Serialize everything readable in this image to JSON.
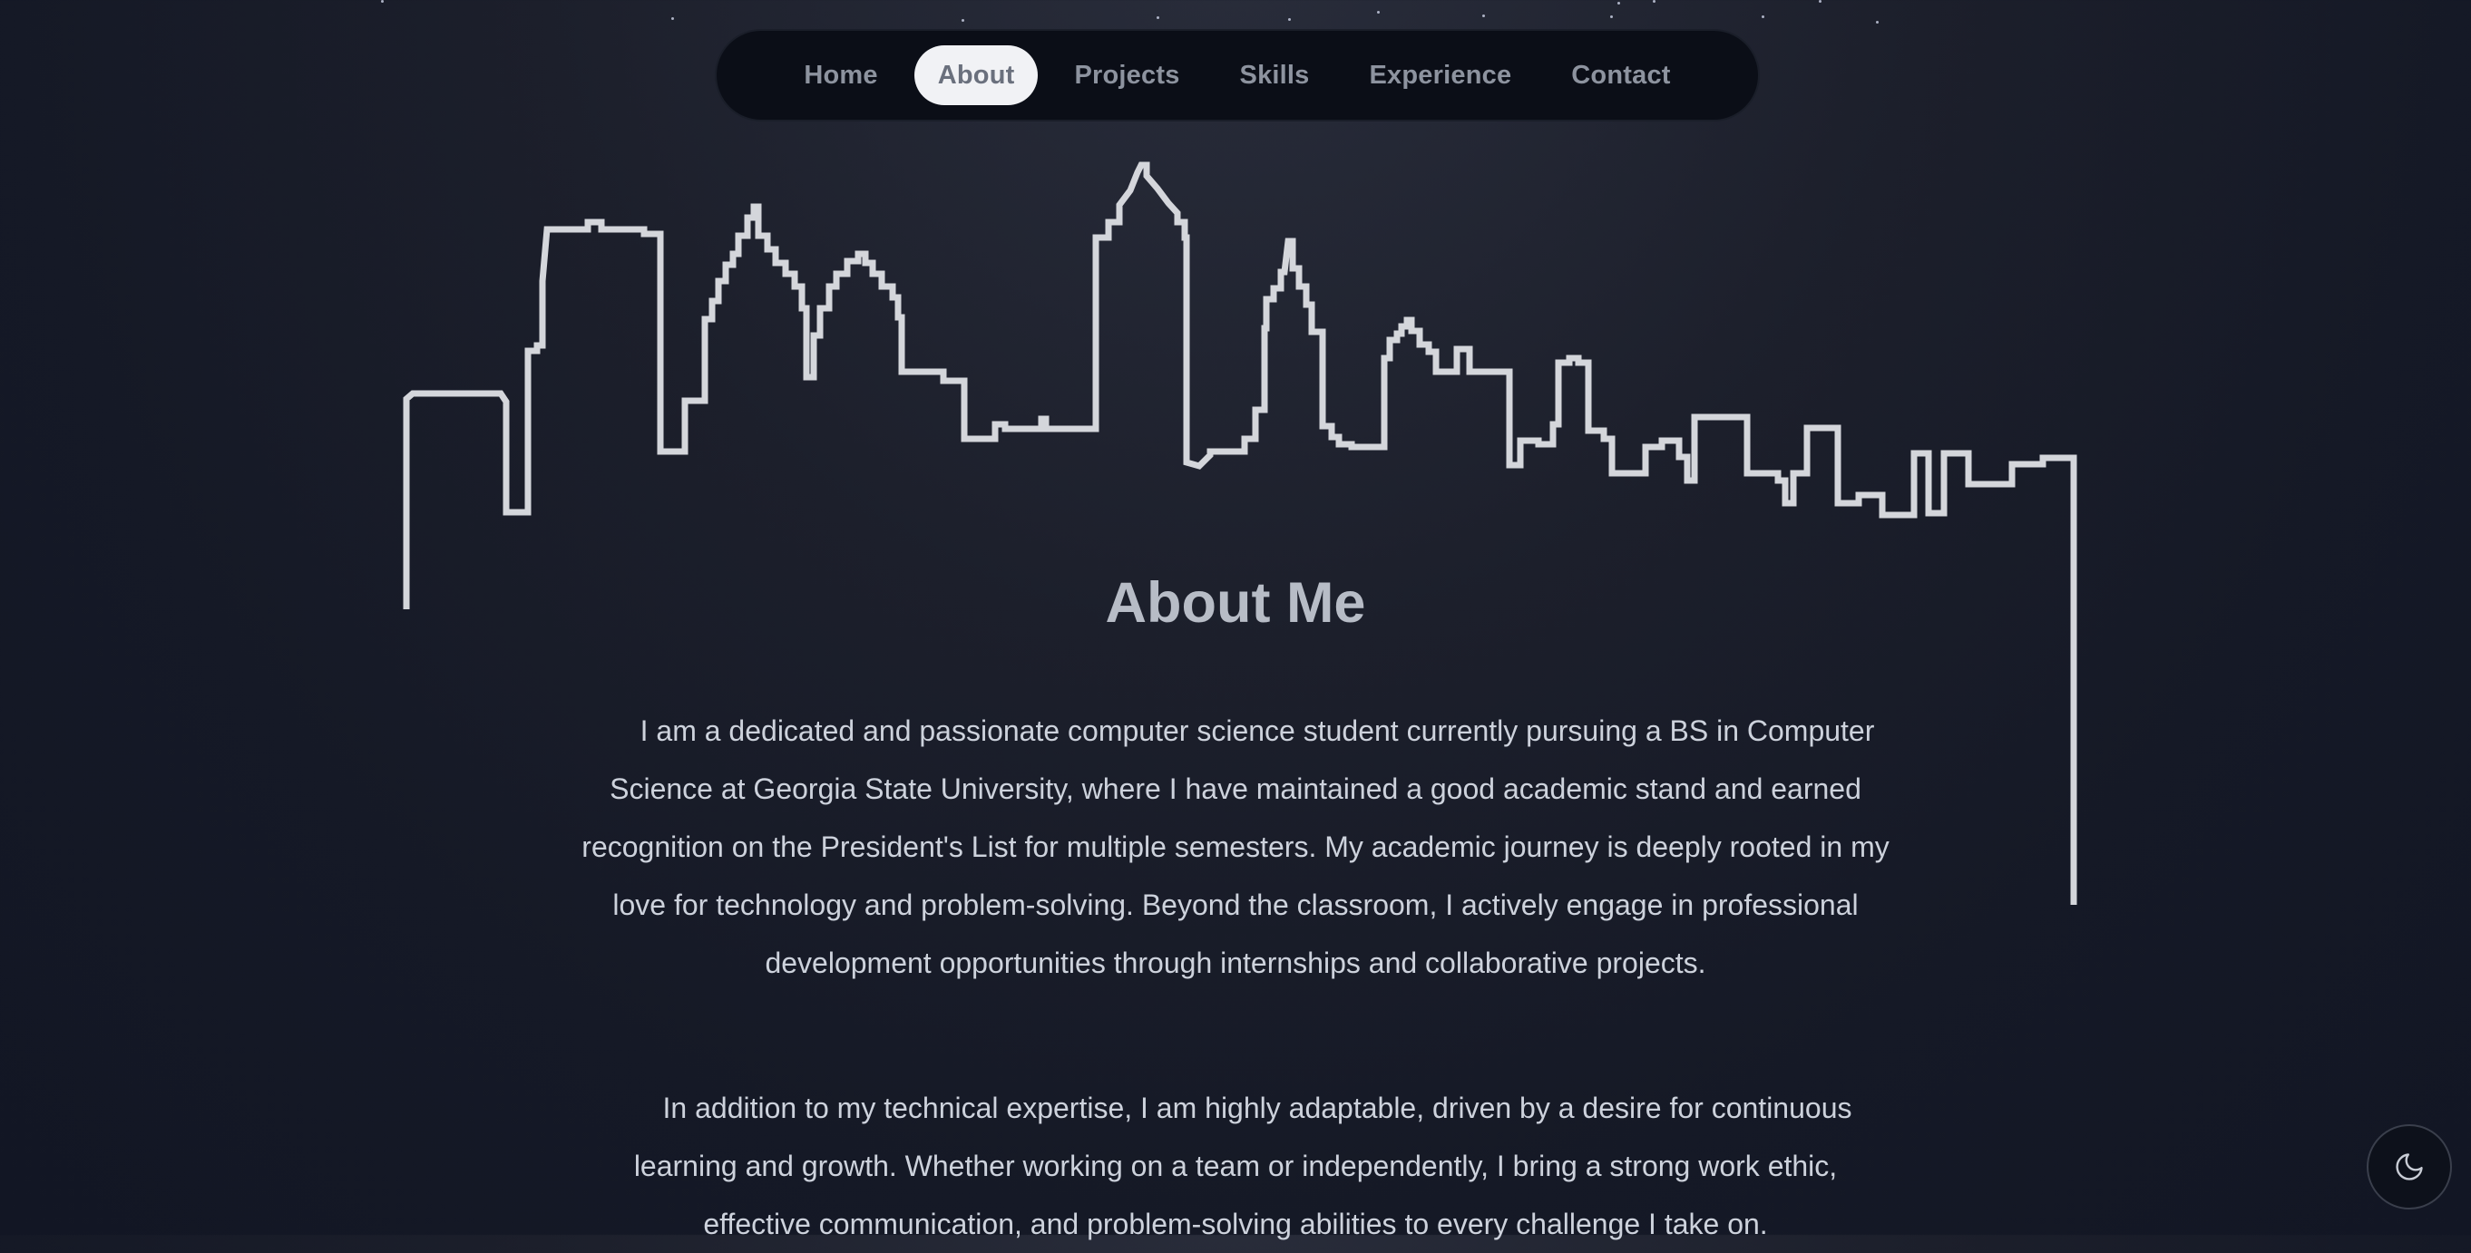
{
  "nav": {
    "items": [
      {
        "label": "Home",
        "active": false
      },
      {
        "label": "About",
        "active": true
      },
      {
        "label": "Projects",
        "active": false
      },
      {
        "label": "Skills",
        "active": false
      },
      {
        "label": "Experience",
        "active": false
      },
      {
        "label": "Contact",
        "active": false
      }
    ]
  },
  "about": {
    "title": "About Me",
    "paragraphs": [
      "I am a dedicated and passionate computer science student currently pursuing a BS in Computer Science at Georgia State University, where I have maintained a good academic stand and earned recognition on the President's List for multiple semesters. My academic journey is deeply rooted in my love for technology and problem-solving. Beyond the classroom, I actively engage in professional development opportunities through internships and collaborative projects.",
      "In addition to my technical expertise, I am highly adaptable, driven by a desire for continuous learning and growth. Whether working on a team or independently, I bring a strong work ethic, effective communication, and problem-solving abilities to every challenge I take on."
    ]
  },
  "theme_toggle": {
    "icon": "moon-icon"
  },
  "colors": {
    "background": "#151926",
    "nav_background": "#0b0e17",
    "nav_active": "#f1f2f5",
    "skyline_stroke": "#d4d6db",
    "text": "#cdd2dc"
  }
}
